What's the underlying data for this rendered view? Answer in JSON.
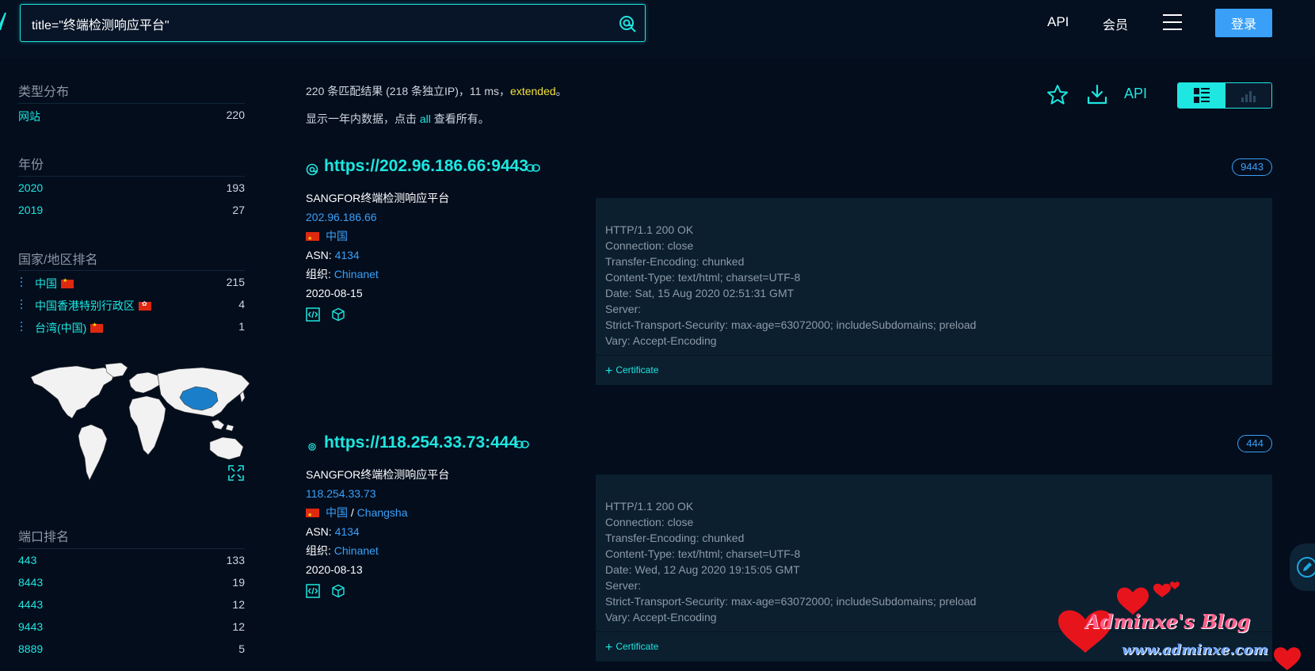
{
  "search": {
    "query": "title=\"终端检测响应平台\""
  },
  "nav": {
    "api_label": "API",
    "member_label": "会员",
    "login_label": "登录"
  },
  "sidebar": {
    "type_dist": {
      "title": "类型分布",
      "items": [
        {
          "label": "网站",
          "count": "220"
        }
      ]
    },
    "year": {
      "title": "年份",
      "items": [
        {
          "label": "2020",
          "count": "193"
        },
        {
          "label": "2019",
          "count": "27"
        }
      ]
    },
    "country": {
      "title": "国家/地区排名",
      "items": [
        {
          "label": "中国",
          "count": "215"
        },
        {
          "label": "中国香港特别行政区",
          "count": "4"
        },
        {
          "label": "台湾(中国)",
          "count": "1"
        }
      ]
    },
    "port": {
      "title": "端口排名",
      "items": [
        {
          "label": "443",
          "count": "133"
        },
        {
          "label": "8443",
          "count": "19"
        },
        {
          "label": "4443",
          "count": "12"
        },
        {
          "label": "9443",
          "count": "12"
        },
        {
          "label": "8889",
          "count": "5"
        }
      ]
    }
  },
  "summary": {
    "text": "220 条匹配结果 (218 条独立IP)，11 ms，",
    "extended": "extended",
    "end": "。",
    "hint_pre": "显示一年内数据，点击 ",
    "hint_all": "all",
    "hint_post": " 查看所有。"
  },
  "toolbar": {
    "api_label": "API"
  },
  "results": [
    {
      "url": "https://202.96.186.66:9443",
      "port": "9443",
      "title": "SANGFOR终端检测响应平台",
      "ip": "202.96.186.66",
      "country": "中国",
      "city": "",
      "asn_key": "ASN:",
      "asn": "4134",
      "org_key": "组织:",
      "org": "Chinanet",
      "date": "2020-08-15",
      "banner": "HTTP/1.1 200 OK\nConnection: close\nTransfer-Encoding: chunked\nContent-Type: text/html; charset=UTF-8\nDate: Sat, 15 Aug 2020 02:51:31 GMT\nServer:\nStrict-Transport-Security: max-age=63072000; includeSubdomains; preload\nVary: Accept-Encoding",
      "cert_label": "Certificate"
    },
    {
      "url": "https://118.254.33.73:444",
      "port": "444",
      "title": "SANGFOR终端检测响应平台",
      "ip": "118.254.33.73",
      "country": "中国",
      "city": "Changsha",
      "asn_key": "ASN:",
      "asn": "4134",
      "org_key": "组织:",
      "org": "Chinanet",
      "date": "2020-08-13",
      "banner": "HTTP/1.1 200 OK\nConnection: close\nTransfer-Encoding: chunked\nContent-Type: text/html; charset=UTF-8\nDate: Wed, 12 Aug 2020 19:15:05 GMT\nServer:\nStrict-Transport-Security: max-age=63072000; includeSubdomains; preload\nVary: Accept-Encoding",
      "cert_label": "Certificate"
    }
  ],
  "watermark": {
    "title": "Adminxe's Blog",
    "url": "www.adminxe.com"
  },
  "colors": {
    "accent": "#1ee6e0",
    "link": "#3aa0f7",
    "background": "#030d1c",
    "highlight": "#f5e23a"
  }
}
